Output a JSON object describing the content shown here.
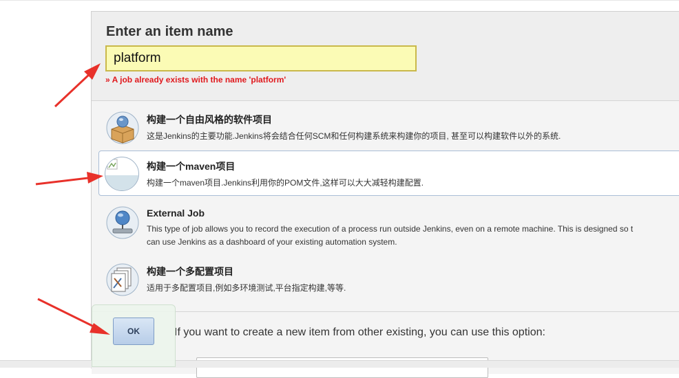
{
  "header": {
    "title": "Enter an item name",
    "name_value": "platform",
    "error": "» A job already exists with the name 'platform'"
  },
  "items": [
    {
      "title": "构建一个自由风格的软件项目",
      "description": "这是Jenkins的主要功能.Jenkins将会结合任何SCM和任何构建系统来构建你的项目, 甚至可以构建软件以外的系统.",
      "icon": "freestyle-package-icon"
    },
    {
      "title": "构建一个maven项目",
      "description": "构建一个maven项目.Jenkins利用你的POM文件,这样可以大大减轻构建配置.",
      "icon": "broken-image-icon"
    },
    {
      "title": "External Job",
      "description_line1": "This type of job allows you to record the execution of a process run outside Jenkins, even on a remote machine. This is designed so t",
      "description_line2": "can use Jenkins as a dashboard of your existing automation system.",
      "icon": "monitor-globe-icon"
    },
    {
      "title": "构建一个多配置项目",
      "description": "适用于多配置项目,例如多环境测试,平台指定构建,等等.",
      "icon": "multi-config-icon"
    }
  ],
  "copy": {
    "text": "If you want to create a new item from other existing, you can use this option:"
  },
  "ok_button": {
    "label": "OK"
  },
  "colors": {
    "error": "#e0181c",
    "input_bg": "#fbfbb5",
    "arrow": "#e8312a",
    "selected_border": "#a9bdd6"
  }
}
